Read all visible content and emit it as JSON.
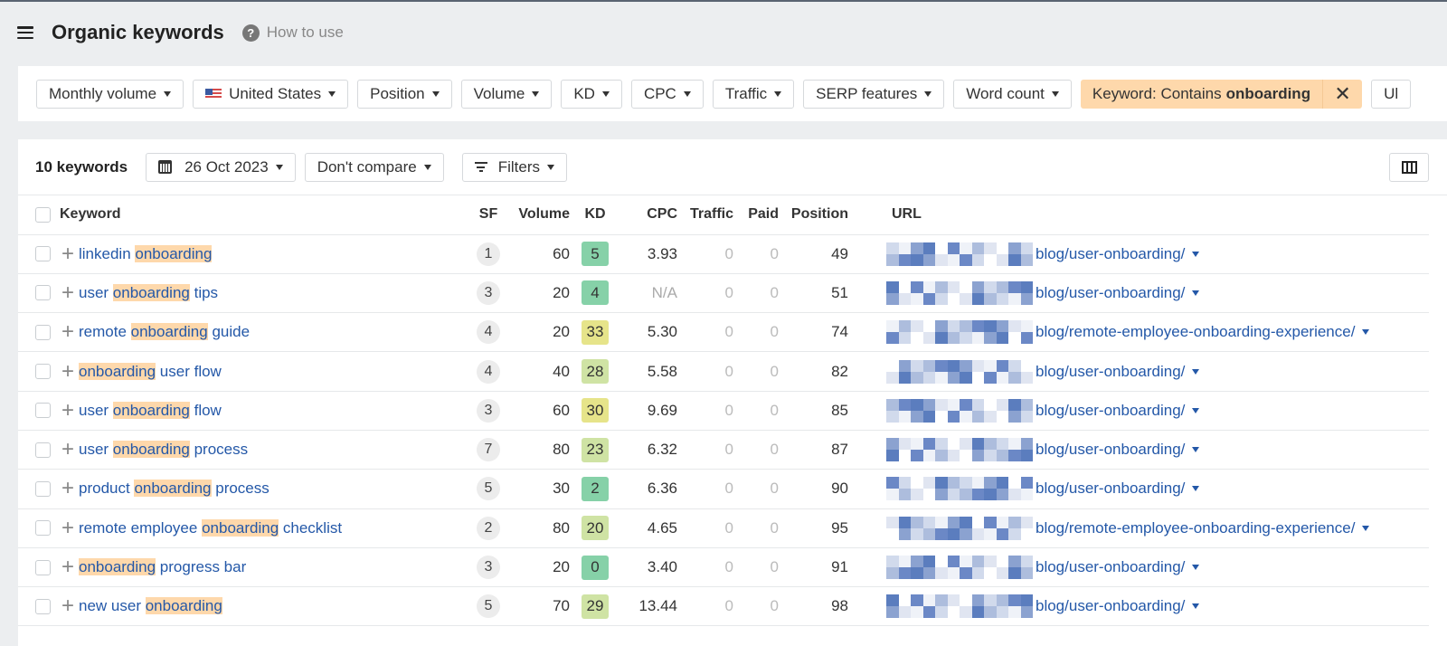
{
  "header": {
    "title": "Organic keywords",
    "help_label": "How to use",
    "help_icon": "?"
  },
  "filters": {
    "items": [
      {
        "label": "Monthly volume",
        "icon": null
      },
      {
        "label": "United States",
        "icon": "us-flag-icon"
      },
      {
        "label": "Position",
        "icon": null
      },
      {
        "label": "Volume",
        "icon": null
      },
      {
        "label": "KD",
        "icon": null
      },
      {
        "label": "CPC",
        "icon": null
      },
      {
        "label": "Traffic",
        "icon": null
      },
      {
        "label": "SERP features",
        "icon": null
      },
      {
        "label": "Word count",
        "icon": null
      }
    ],
    "active_filter": {
      "prefix": "Keyword: Contains",
      "value": "onboarding",
      "close_icon": "✕"
    },
    "overflow_label": "Ul"
  },
  "toolbar": {
    "count_label": "10 keywords",
    "date_label": "26 Oct 2023",
    "compare_label": "Don't compare",
    "filters_label": "Filters"
  },
  "table": {
    "columns": [
      "Keyword",
      "SF",
      "Volume",
      "KD",
      "CPC",
      "Traffic",
      "Paid",
      "Position",
      "URL"
    ],
    "highlight_term": "onboarding",
    "kd_colors": {
      "green": "#86d1a8",
      "light_green": "#cfe3a4",
      "yellow": "#e6e48a"
    },
    "rows": [
      {
        "pre": "linkedin ",
        "hl": "onboarding",
        "post": "",
        "sf": "1",
        "volume": "60",
        "kd": "5",
        "kd_color": "#86d1a8",
        "cpc": "3.93",
        "traffic": "0",
        "paid": "0",
        "position": "49",
        "url": "blog/user-onboarding/"
      },
      {
        "pre": "user ",
        "hl": "onboarding",
        "post": " tips",
        "sf": "3",
        "volume": "20",
        "kd": "4",
        "kd_color": "#86d1a8",
        "cpc": "N/A",
        "traffic": "0",
        "paid": "0",
        "position": "51",
        "url": "blog/user-onboarding/"
      },
      {
        "pre": "remote ",
        "hl": "onboarding",
        "post": " guide",
        "sf": "4",
        "volume": "20",
        "kd": "33",
        "kd_color": "#e6e48a",
        "cpc": "5.30",
        "traffic": "0",
        "paid": "0",
        "position": "74",
        "url": "blog/remote-employee-onboarding-experience/"
      },
      {
        "pre": "",
        "hl": "onboarding",
        "post": " user flow",
        "sf": "4",
        "volume": "40",
        "kd": "28",
        "kd_color": "#cfe3a4",
        "cpc": "5.58",
        "traffic": "0",
        "paid": "0",
        "position": "82",
        "url": "blog/user-onboarding/"
      },
      {
        "pre": "user ",
        "hl": "onboarding",
        "post": " flow",
        "sf": "3",
        "volume": "60",
        "kd": "30",
        "kd_color": "#e6e48a",
        "cpc": "9.69",
        "traffic": "0",
        "paid": "0",
        "position": "85",
        "url": "blog/user-onboarding/"
      },
      {
        "pre": "user ",
        "hl": "onboarding",
        "post": " process",
        "sf": "7",
        "volume": "80",
        "kd": "23",
        "kd_color": "#cfe3a4",
        "cpc": "6.32",
        "traffic": "0",
        "paid": "0",
        "position": "87",
        "url": "blog/user-onboarding/"
      },
      {
        "pre": "product ",
        "hl": "onboarding",
        "post": " process",
        "sf": "5",
        "volume": "30",
        "kd": "2",
        "kd_color": "#86d1a8",
        "cpc": "6.36",
        "traffic": "0",
        "paid": "0",
        "position": "90",
        "url": "blog/user-onboarding/"
      },
      {
        "pre": "remote employee ",
        "hl": "onboarding",
        "post": " checklist",
        "sf": "2",
        "volume": "80",
        "kd": "20",
        "kd_color": "#cfe3a4",
        "cpc": "4.65",
        "traffic": "0",
        "paid": "0",
        "position": "95",
        "url": "blog/remote-employee-onboarding-experience/"
      },
      {
        "pre": "",
        "hl": "onboarding",
        "post": " progress bar",
        "sf": "3",
        "volume": "20",
        "kd": "0",
        "kd_color": "#86d1a8",
        "cpc": "3.40",
        "traffic": "0",
        "paid": "0",
        "position": "91",
        "url": "blog/user-onboarding/"
      },
      {
        "pre": "new user ",
        "hl": "onboarding",
        "post": "",
        "sf": "5",
        "volume": "70",
        "kd": "29",
        "kd_color": "#cfe3a4",
        "cpc": "13.44",
        "traffic": "0",
        "paid": "0",
        "position": "98",
        "url": "blog/user-onboarding/"
      }
    ]
  }
}
